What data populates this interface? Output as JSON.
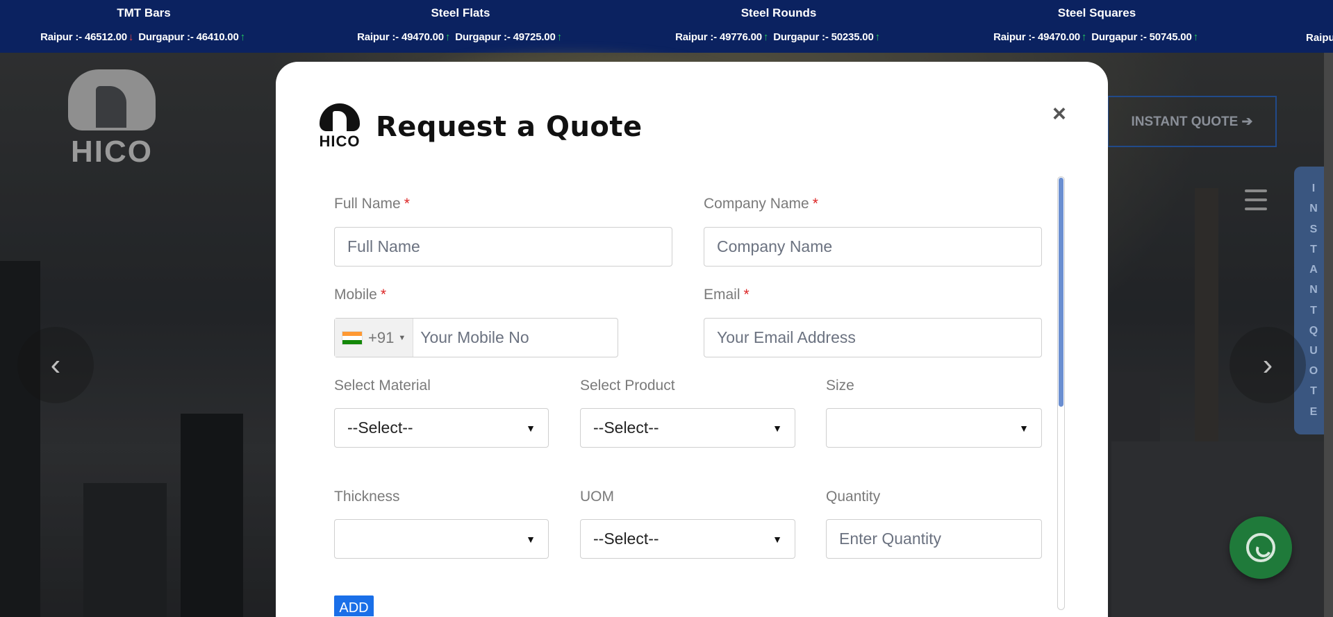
{
  "ticker": {
    "items": [
      {
        "title": "TMT Bars",
        "raipur_label": "Raipur :-",
        "raipur_value": "46512.00",
        "raipur_trend": "down",
        "durgapur_label": "Durgapur :-",
        "durgapur_value": "46410.00",
        "durgapur_trend": "up"
      },
      {
        "title": "Steel Flats",
        "raipur_label": "Raipur :-",
        "raipur_value": "49470.00",
        "raipur_trend": "up",
        "durgapur_label": "Durgapur :-",
        "durgapur_value": "49725.00",
        "durgapur_trend": "up"
      },
      {
        "title": "Steel Rounds",
        "raipur_label": "Raipur :-",
        "raipur_value": "49776.00",
        "raipur_trend": "up",
        "durgapur_label": "Durgapur :-",
        "durgapur_value": "50235.00",
        "durgapur_trend": "up"
      },
      {
        "title": "Steel Squares",
        "raipur_label": "Raipur :-",
        "raipur_value": "49470.00",
        "raipur_trend": "up",
        "durgapur_label": "Durgapur :-",
        "durgapur_value": "50745.00",
        "durgapur_trend": "up"
      }
    ],
    "partial_text": "Raipu",
    "up_arrow": "↑",
    "down_arrow": "↓",
    "colors": {
      "background": "#0b2260",
      "up": "#22c55e",
      "down": "#ef4444"
    }
  },
  "header": {
    "logo_text": "HICO",
    "instant_quote_label": "INSTANT QUOTE ➔",
    "side_tab_letters": [
      "I",
      "N",
      "S",
      "T",
      "A",
      "N",
      "T",
      "Q",
      "U",
      "O",
      "T",
      "E"
    ],
    "prev_glyph": "‹",
    "next_glyph": "›"
  },
  "modal": {
    "brand_text": "HICO",
    "title": "Request a Quote",
    "close_glyph": "×",
    "required_mark": "*",
    "fields": {
      "full_name": {
        "label": "Full Name",
        "placeholder": "Full Name"
      },
      "company_name": {
        "label": "Company Name",
        "placeholder": "Company Name"
      },
      "mobile": {
        "label": "Mobile",
        "country_code": "+91",
        "placeholder": "Your Mobile No"
      },
      "email": {
        "label": "Email",
        "placeholder": "Your Email Address"
      },
      "material": {
        "label": "Select Material",
        "value": "--Select--"
      },
      "product": {
        "label": "Select Product",
        "value": "--Select--"
      },
      "size": {
        "label": "Size",
        "value": ""
      },
      "thickness": {
        "label": "Thickness",
        "value": ""
      },
      "uom": {
        "label": "UOM",
        "value": "--Select--"
      },
      "quantity": {
        "label": "Quantity",
        "placeholder": "Enter Quantity"
      }
    },
    "add_label": "ADD",
    "caret": "▼",
    "accent_color": "#1a6fe8"
  }
}
